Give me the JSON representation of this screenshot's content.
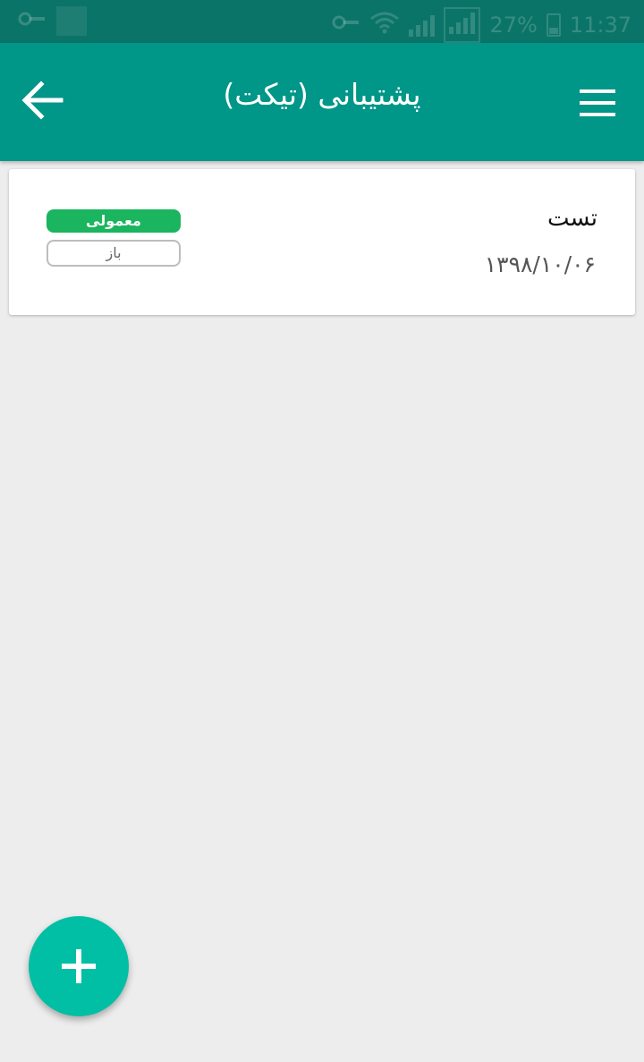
{
  "status_bar": {
    "battery": "27%",
    "time": "11:37",
    "icons": [
      "vpn-key-icon",
      "notification-icon",
      "vpn-key-icon",
      "wifi-icon",
      "signal-icon",
      "signal-icon",
      "battery-icon"
    ]
  },
  "app_bar": {
    "title": "پشتیبانی (تیکت)",
    "back_icon": "arrow-left-icon",
    "menu_icon": "hamburger-menu-icon",
    "color": "#009688"
  },
  "tickets": [
    {
      "title": "تست",
      "date": "۱۳۹۸/۱۰/۰۶",
      "priority": "معمولی",
      "status": "باز",
      "priority_color": "#1ab55e"
    }
  ],
  "fab": {
    "icon": "plus-icon",
    "color": "#00bfa5"
  }
}
